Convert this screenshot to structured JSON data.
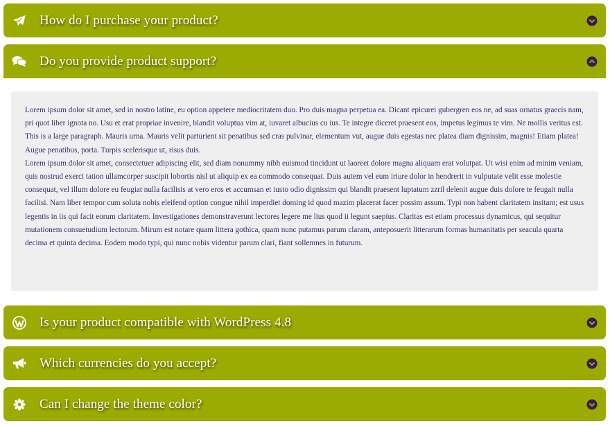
{
  "colors": {
    "accent": "#9cab00",
    "panel_background": "#efefef",
    "answer_text": "#3d2b6b",
    "toggle_icon": "#3a1a56"
  },
  "faq": {
    "items": [
      {
        "icon": "paper-plane-icon",
        "question": "How do I purchase your product?",
        "expanded": false,
        "toggle_icon": "chevron-down-circle-icon"
      },
      {
        "icon": "comments-icon",
        "question": "Do you provide product support?",
        "expanded": true,
        "toggle_icon": "chevron-up-circle-icon",
        "answer": [
          "Lorem ipsum dolor sit amet, sed in nostro latine, eu option appetere mediocritatem duo. Pro duis magna perpetua ea. Dicant epicurei gubergren eos ne, ad suas ornatus graecis nam, pri quot liber ignota no. Usu et erat propriae invenire, blandit voluptua vim at, iuvaret albucius cu ius. Te integre diceret praesent eos, impetus legimus te vim. Ne mollis veritus est.",
          "This is a large paragraph. Mauris urna. Mauris velit parturient sit penatibus sed cras pulvinar, elementum vut, augue duis egestas nec platea diam dignissim, magnis! Etiam platea! Augue penatibus, porta. Turpis scelerisque ut, risus duis.",
          "Lorem ipsum dolor sit amet, consectetuer adipiscing elit, sed diam nonummy nibh euismod tincidunt ut laoreet dolore magna aliquam erat volutpat. Ut wisi enim ad minim veniam, quis nostrud exerci tation ullamcorper suscipit lobortis nisl ut aliquip ex ea commodo consequat. Duis autem vel eum iriure dolor in hendrerit in vulputate velit esse molestie consequat, vel illum dolore eu feugiat nulla facilisis at vero eros et accumsan et iusto odio dignissim qui blandit praesent luptatum zzril delenit augue duis dolore te feugait nulla facilisi. Nam liber tempor cum soluta nobis eleifend option congue nihil imperdiet doming id quod mazim placerat facer possim assum. Typi non habent claritatem insitam; est usus legentis in iis qui facit eorum claritatem. Investigationes demonstraverunt lectores legere me lius quod ii legunt saepius. Claritas est etiam processus dynamicus, qui sequitur mutationem consuetudium lectorum. Mirum est notare quam littera gothica, quam nunc putamus parum claram, anteposuerit litterarum formas humanitatis per seacula quarta decima et quinta decima. Eodem modo typi, qui nunc nobis videntur parum clari, fiant sollemnes in futurum."
        ]
      },
      {
        "icon": "wordpress-icon",
        "question": "Is your product compatible with WordPress 4.8",
        "expanded": false,
        "toggle_icon": "chevron-down-circle-icon"
      },
      {
        "icon": "bullhorn-icon",
        "question": "Which currencies do you accept?",
        "expanded": false,
        "toggle_icon": "chevron-down-circle-icon"
      },
      {
        "icon": "gear-icon",
        "question": "Can I change the theme color?",
        "expanded": false,
        "toggle_icon": "chevron-down-circle-icon"
      }
    ]
  }
}
